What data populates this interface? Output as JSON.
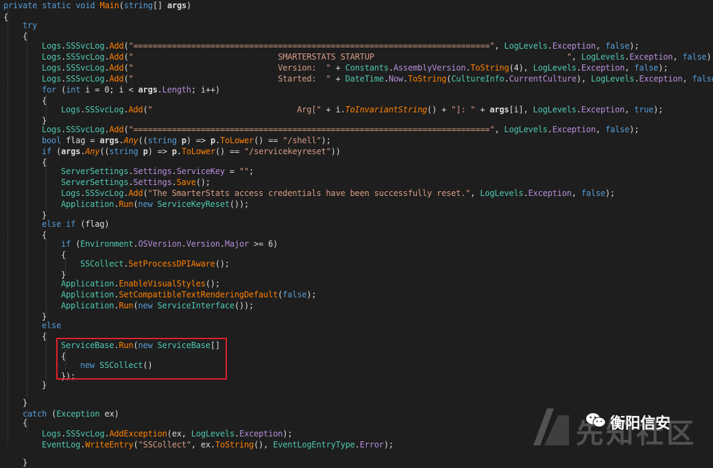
{
  "code_lines": [
    {
      "indent": 0,
      "tokens": [
        [
          "kw",
          "private"
        ],
        [
          "pl",
          " "
        ],
        [
          "kw",
          "static"
        ],
        [
          "pl",
          " "
        ],
        [
          "kw",
          "void"
        ],
        [
          "pl",
          " "
        ],
        [
          "me",
          "Main"
        ],
        [
          "pl",
          "("
        ],
        [
          "kw",
          "string"
        ],
        [
          "pl",
          "[] "
        ],
        [
          "bo",
          "args"
        ],
        [
          "pl",
          ")"
        ]
      ]
    },
    {
      "indent": 0,
      "tokens": [
        [
          "pl",
          "{"
        ]
      ]
    },
    {
      "indent": 1,
      "tokens": [
        [
          "kw",
          "try"
        ]
      ]
    },
    {
      "indent": 1,
      "tokens": [
        [
          "pl",
          "{"
        ]
      ]
    },
    {
      "indent": 2,
      "tokens": [
        [
          "ty",
          "Logs"
        ],
        [
          "pl",
          "."
        ],
        [
          "ty",
          "SSSvcLog"
        ],
        [
          "pl",
          "."
        ],
        [
          "me",
          "Add"
        ],
        [
          "pl",
          "("
        ],
        [
          "st",
          "\"==========================================================================\""
        ],
        [
          "pl",
          ", "
        ],
        [
          "ty",
          "LogLevels"
        ],
        [
          "pl",
          "."
        ],
        [
          "en",
          "Exception"
        ],
        [
          "pl",
          ", "
        ],
        [
          "kw",
          "false"
        ],
        [
          "pl",
          ");"
        ]
      ]
    },
    {
      "indent": 2,
      "tokens": [
        [
          "ty",
          "Logs"
        ],
        [
          "pl",
          "."
        ],
        [
          "ty",
          "SSSvcLog"
        ],
        [
          "pl",
          "."
        ],
        [
          "me",
          "Add"
        ],
        [
          "pl",
          "("
        ],
        [
          "st",
          "\"                              SMARTERSTATS STARTUP                                        \""
        ],
        [
          "pl",
          ", "
        ],
        [
          "ty",
          "LogLevels"
        ],
        [
          "pl",
          "."
        ],
        [
          "en",
          "Exception"
        ],
        [
          "pl",
          ", "
        ],
        [
          "kw",
          "false"
        ],
        [
          "pl",
          ");"
        ]
      ]
    },
    {
      "indent": 2,
      "tokens": [
        [
          "ty",
          "Logs"
        ],
        [
          "pl",
          "."
        ],
        [
          "ty",
          "SSSvcLog"
        ],
        [
          "pl",
          "."
        ],
        [
          "me",
          "Add"
        ],
        [
          "pl",
          "("
        ],
        [
          "st",
          "\"                              Version:  \""
        ],
        [
          "pl",
          " + "
        ],
        [
          "ty",
          "Constants"
        ],
        [
          "pl",
          "."
        ],
        [
          "fi",
          "AssemblyVersion"
        ],
        [
          "pl",
          "."
        ],
        [
          "me",
          "ToString"
        ],
        [
          "pl",
          "(4), "
        ],
        [
          "ty",
          "LogLevels"
        ],
        [
          "pl",
          "."
        ],
        [
          "en",
          "Exception"
        ],
        [
          "pl",
          ", "
        ],
        [
          "kw",
          "false"
        ],
        [
          "pl",
          ");"
        ]
      ]
    },
    {
      "indent": 2,
      "tokens": [
        [
          "ty",
          "Logs"
        ],
        [
          "pl",
          "."
        ],
        [
          "ty",
          "SSSvcLog"
        ],
        [
          "pl",
          "."
        ],
        [
          "me",
          "Add"
        ],
        [
          "pl",
          "("
        ],
        [
          "st",
          "\"                              Started:  \""
        ],
        [
          "pl",
          " + "
        ],
        [
          "ty",
          "DateTime"
        ],
        [
          "pl",
          "."
        ],
        [
          "fi",
          "Now"
        ],
        [
          "pl",
          "."
        ],
        [
          "me",
          "ToString"
        ],
        [
          "pl",
          "("
        ],
        [
          "ty",
          "CultureInfo"
        ],
        [
          "pl",
          "."
        ],
        [
          "fi",
          "CurrentCulture"
        ],
        [
          "pl",
          "), "
        ],
        [
          "ty",
          "LogLevels"
        ],
        [
          "pl",
          "."
        ],
        [
          "en",
          "Exception"
        ],
        [
          "pl",
          ", "
        ],
        [
          "kw",
          "false"
        ],
        [
          "pl",
          ");"
        ]
      ]
    },
    {
      "indent": 2,
      "tokens": [
        [
          "kw",
          "for"
        ],
        [
          "pl",
          " ("
        ],
        [
          "kw",
          "int"
        ],
        [
          "pl",
          " i = 0; i < "
        ],
        [
          "bo",
          "args"
        ],
        [
          "pl",
          "."
        ],
        [
          "fi",
          "Length"
        ],
        [
          "pl",
          "; i++)"
        ]
      ]
    },
    {
      "indent": 2,
      "tokens": [
        [
          "pl",
          "{"
        ]
      ]
    },
    {
      "indent": 3,
      "tokens": [
        [
          "ty",
          "Logs"
        ],
        [
          "pl",
          "."
        ],
        [
          "ty",
          "SSSvcLog"
        ],
        [
          "pl",
          "."
        ],
        [
          "me",
          "Add"
        ],
        [
          "pl",
          "("
        ],
        [
          "st",
          "\"                              Arg[\""
        ],
        [
          "pl",
          " + i."
        ],
        [
          "ext",
          "ToInvariantString"
        ],
        [
          "pl",
          "() + "
        ],
        [
          "st",
          "\"]: \""
        ],
        [
          "pl",
          " + "
        ],
        [
          "bo",
          "args"
        ],
        [
          "pl",
          "[i], "
        ],
        [
          "ty",
          "LogLevels"
        ],
        [
          "pl",
          "."
        ],
        [
          "en",
          "Exception"
        ],
        [
          "pl",
          ", "
        ],
        [
          "kw",
          "true"
        ],
        [
          "pl",
          ");"
        ]
      ]
    },
    {
      "indent": 2,
      "tokens": [
        [
          "pl",
          "}"
        ]
      ]
    },
    {
      "indent": 2,
      "tokens": [
        [
          "ty",
          "Logs"
        ],
        [
          "pl",
          "."
        ],
        [
          "ty",
          "SSSvcLog"
        ],
        [
          "pl",
          "."
        ],
        [
          "me",
          "Add"
        ],
        [
          "pl",
          "("
        ],
        [
          "st",
          "\"==========================================================================\""
        ],
        [
          "pl",
          ", "
        ],
        [
          "ty",
          "LogLevels"
        ],
        [
          "pl",
          "."
        ],
        [
          "en",
          "Exception"
        ],
        [
          "pl",
          ", "
        ],
        [
          "kw",
          "false"
        ],
        [
          "pl",
          ");"
        ]
      ]
    },
    {
      "indent": 2,
      "tokens": [
        [
          "kw",
          "bool"
        ],
        [
          "pl",
          " flag = "
        ],
        [
          "bo",
          "args"
        ],
        [
          "pl",
          "."
        ],
        [
          "ext",
          "Any"
        ],
        [
          "pl",
          "(("
        ],
        [
          "kw",
          "string"
        ],
        [
          "pl",
          " "
        ],
        [
          "bo",
          "p"
        ],
        [
          "pl",
          ") => "
        ],
        [
          "bo",
          "p"
        ],
        [
          "pl",
          "."
        ],
        [
          "me",
          "ToLower"
        ],
        [
          "pl",
          "() == "
        ],
        [
          "st",
          "\"/shell\""
        ],
        [
          "pl",
          ");"
        ]
      ]
    },
    {
      "indent": 2,
      "tokens": [
        [
          "kw",
          "if"
        ],
        [
          "pl",
          " ("
        ],
        [
          "bo",
          "args"
        ],
        [
          "pl",
          "."
        ],
        [
          "ext",
          "Any"
        ],
        [
          "pl",
          "(("
        ],
        [
          "kw",
          "string"
        ],
        [
          "pl",
          " "
        ],
        [
          "bo",
          "p"
        ],
        [
          "pl",
          ") => "
        ],
        [
          "bo",
          "p"
        ],
        [
          "pl",
          "."
        ],
        [
          "me",
          "ToLower"
        ],
        [
          "pl",
          "() == "
        ],
        [
          "st",
          "\"/servicekeyreset\""
        ],
        [
          "pl",
          "))"
        ]
      ]
    },
    {
      "indent": 2,
      "tokens": [
        [
          "pl",
          "{"
        ]
      ]
    },
    {
      "indent": 3,
      "tokens": [
        [
          "ty",
          "ServerSettings"
        ],
        [
          "pl",
          "."
        ],
        [
          "fi",
          "Settings"
        ],
        [
          "pl",
          "."
        ],
        [
          "fi",
          "ServiceKey"
        ],
        [
          "pl",
          " = "
        ],
        [
          "st",
          "\"\""
        ],
        [
          "pl",
          ";"
        ]
      ]
    },
    {
      "indent": 3,
      "tokens": [
        [
          "ty",
          "ServerSettings"
        ],
        [
          "pl",
          "."
        ],
        [
          "fi",
          "Settings"
        ],
        [
          "pl",
          "."
        ],
        [
          "me",
          "Save"
        ],
        [
          "pl",
          "();"
        ]
      ]
    },
    {
      "indent": 3,
      "tokens": [
        [
          "ty",
          "Logs"
        ],
        [
          "pl",
          "."
        ],
        [
          "ty",
          "SSSvcLog"
        ],
        [
          "pl",
          "."
        ],
        [
          "me",
          "Add"
        ],
        [
          "pl",
          "("
        ],
        [
          "st",
          "\"The SmarterStats access credentials have been successfully reset.\""
        ],
        [
          "pl",
          ", "
        ],
        [
          "ty",
          "LogLevels"
        ],
        [
          "pl",
          "."
        ],
        [
          "en",
          "Exception"
        ],
        [
          "pl",
          ", "
        ],
        [
          "kw",
          "false"
        ],
        [
          "pl",
          ");"
        ]
      ]
    },
    {
      "indent": 3,
      "tokens": [
        [
          "ty",
          "Application"
        ],
        [
          "pl",
          "."
        ],
        [
          "me",
          "Run"
        ],
        [
          "pl",
          "("
        ],
        [
          "kw",
          "new"
        ],
        [
          "pl",
          " "
        ],
        [
          "ty",
          "ServiceKeyReset"
        ],
        [
          "pl",
          "());"
        ]
      ]
    },
    {
      "indent": 2,
      "tokens": [
        [
          "pl",
          "}"
        ]
      ]
    },
    {
      "indent": 2,
      "tokens": [
        [
          "kw",
          "else if"
        ],
        [
          "pl",
          " (flag)"
        ]
      ]
    },
    {
      "indent": 2,
      "tokens": [
        [
          "pl",
          "{"
        ]
      ]
    },
    {
      "indent": 3,
      "tokens": [
        [
          "kw",
          "if"
        ],
        [
          "pl",
          " ("
        ],
        [
          "ty",
          "Environment"
        ],
        [
          "pl",
          "."
        ],
        [
          "fi",
          "OSVersion"
        ],
        [
          "pl",
          "."
        ],
        [
          "fi",
          "Version"
        ],
        [
          "pl",
          "."
        ],
        [
          "fi",
          "Major"
        ],
        [
          "pl",
          " >= 6)"
        ]
      ]
    },
    {
      "indent": 3,
      "tokens": [
        [
          "pl",
          "{"
        ]
      ]
    },
    {
      "indent": 4,
      "tokens": [
        [
          "ty",
          "SSCollect"
        ],
        [
          "pl",
          "."
        ],
        [
          "me",
          "SetProcessDPIAware"
        ],
        [
          "pl",
          "();"
        ]
      ]
    },
    {
      "indent": 3,
      "tokens": [
        [
          "pl",
          "}"
        ]
      ]
    },
    {
      "indent": 3,
      "tokens": [
        [
          "ty",
          "Application"
        ],
        [
          "pl",
          "."
        ],
        [
          "me",
          "EnableVisualStyles"
        ],
        [
          "pl",
          "();"
        ]
      ]
    },
    {
      "indent": 3,
      "tokens": [
        [
          "ty",
          "Application"
        ],
        [
          "pl",
          "."
        ],
        [
          "me",
          "SetCompatibleTextRenderingDefault"
        ],
        [
          "pl",
          "("
        ],
        [
          "kw",
          "false"
        ],
        [
          "pl",
          ");"
        ]
      ]
    },
    {
      "indent": 3,
      "tokens": [
        [
          "ty",
          "Application"
        ],
        [
          "pl",
          "."
        ],
        [
          "me",
          "Run"
        ],
        [
          "pl",
          "("
        ],
        [
          "kw",
          "new"
        ],
        [
          "pl",
          " "
        ],
        [
          "ty",
          "ServiceInterface"
        ],
        [
          "pl",
          "());"
        ]
      ]
    },
    {
      "indent": 2,
      "tokens": [
        [
          "pl",
          "}"
        ]
      ]
    },
    {
      "indent": 2,
      "tokens": [
        [
          "kw",
          "else"
        ]
      ]
    },
    {
      "indent": 2,
      "tokens": [
        [
          "pl",
          "{"
        ]
      ]
    },
    {
      "indent": 3,
      "tokens": [
        [
          "ty",
          "ServiceBase"
        ],
        [
          "pl",
          "."
        ],
        [
          "me",
          "Run"
        ],
        [
          "pl",
          "("
        ],
        [
          "kw",
          "new"
        ],
        [
          "pl",
          " "
        ],
        [
          "ty",
          "ServiceBase"
        ],
        [
          "pl",
          "[]"
        ]
      ]
    },
    {
      "indent": 3,
      "tokens": [
        [
          "pl",
          "{"
        ]
      ]
    },
    {
      "indent": 4,
      "tokens": [
        [
          "kw",
          "new"
        ],
        [
          "pl",
          " "
        ],
        [
          "ty",
          "SSCollect"
        ],
        [
          "pl",
          "()"
        ]
      ]
    },
    {
      "indent": 3,
      "tokens": [
        [
          "pl",
          "});"
        ]
      ]
    },
    {
      "indent": 2,
      "tokens": [
        [
          "pl",
          "}"
        ]
      ]
    },
    {
      "indent": 1,
      "tokens": [
        [
          "pl",
          "}"
        ]
      ]
    },
    {
      "indent": 1,
      "tokens": [
        [
          "kw",
          "catch"
        ],
        [
          "pl",
          " ("
        ],
        [
          "ty",
          "Exception"
        ],
        [
          "pl",
          " ex)"
        ]
      ]
    },
    {
      "indent": 1,
      "tokens": [
        [
          "pl",
          "{"
        ]
      ]
    },
    {
      "indent": 2,
      "tokens": [
        [
          "ty",
          "Logs"
        ],
        [
          "pl",
          "."
        ],
        [
          "ty",
          "SSSvcLog"
        ],
        [
          "pl",
          "."
        ],
        [
          "me",
          "AddException"
        ],
        [
          "pl",
          "(ex, "
        ],
        [
          "ty",
          "LogLevels"
        ],
        [
          "pl",
          "."
        ],
        [
          "en",
          "Exception"
        ],
        [
          "pl",
          ");"
        ]
      ]
    },
    {
      "indent": 2,
      "tokens": [
        [
          "ty",
          "EventLog"
        ],
        [
          "pl",
          "."
        ],
        [
          "me",
          "WriteEntry"
        ],
        [
          "pl",
          "("
        ],
        [
          "st",
          "\"SSCollect\""
        ],
        [
          "pl",
          ", ex."
        ],
        [
          "me",
          "ToString"
        ],
        [
          "pl",
          "(), "
        ],
        [
          "ty",
          "EventLogEntryType"
        ],
        [
          "pl",
          "."
        ],
        [
          "en",
          "Error"
        ],
        [
          "pl",
          ");"
        ]
      ]
    },
    {
      "indent": 1,
      "tokens": [
        [
          "pl",
          "}"
        ]
      ]
    }
  ],
  "watermark": {
    "site_text": "先知社区",
    "author_text": "衡阳信安"
  },
  "colors": {
    "background": "#1e1e1e",
    "highlight_box": "#e0202a"
  }
}
